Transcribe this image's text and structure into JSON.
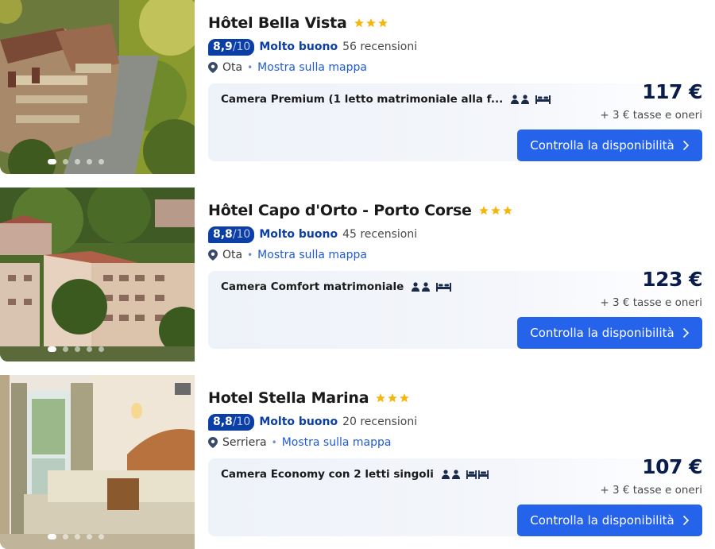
{
  "listings": [
    {
      "name": "Hôtel Bella Vista",
      "stars": 3,
      "score": "8,9",
      "score_max": "/10",
      "rating_word": "Molto buono",
      "reviews": "56 recensioni",
      "city": "Ota",
      "separator": "•",
      "map_link": "Mostra sulla mappa",
      "room": "Camera Premium (1 letto matrimoniale alla f...",
      "guests_icon": "two-persons-icon",
      "bed_icon": "double-bed-icon",
      "price": "117 €",
      "taxes": "+ 3 € tasse e oneri",
      "cta": "Controlla la disponibilità"
    },
    {
      "name": "Hôtel Capo d'Orto - Porto Corse",
      "stars": 3,
      "score": "8,8",
      "score_max": "/10",
      "rating_word": "Molto buono",
      "reviews": "45 recensioni",
      "city": "Ota",
      "separator": "•",
      "map_link": "Mostra sulla mappa",
      "room": "Camera Comfort matrimoniale",
      "guests_icon": "two-persons-icon",
      "bed_icon": "double-bed-icon",
      "price": "123 €",
      "taxes": "+ 3 € tasse e oneri",
      "cta": "Controlla la disponibilità"
    },
    {
      "name": "Hotel Stella Marina",
      "stars": 3,
      "score": "8,8",
      "score_max": "/10",
      "rating_word": "Molto buono",
      "reviews": "20 recensioni",
      "city": "Serriera",
      "separator": "•",
      "map_link": "Mostra sulla mappa",
      "room": "Camera Economy con 2 letti singoli",
      "guests_icon": "two-persons-icon",
      "bed_icon": "two-single-beds-icon",
      "price": "107 €",
      "taxes": "+ 3 € tasse e oneri",
      "cta": "Controlla la disponibilità"
    }
  ],
  "colors": {
    "score_badge": "#0b3fa6",
    "link": "#1f5bd8",
    "cta": "#2563eb",
    "star": "#f5b50a",
    "price": "#0a1d4a"
  }
}
